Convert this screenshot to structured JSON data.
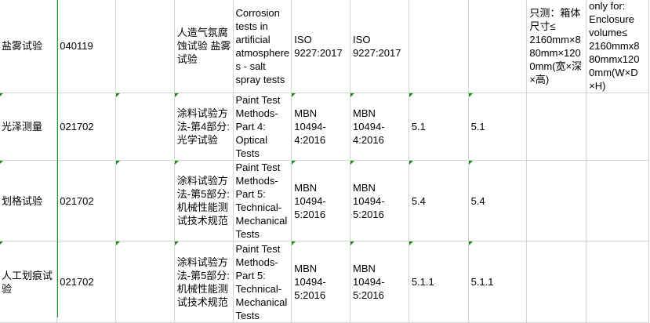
{
  "rows": [
    {
      "name": "row-salt-spray",
      "height": 112,
      "cells": [
        {
          "text": "盐雾试验",
          "mark": false
        },
        {
          "text": "040119",
          "mark": false
        },
        {
          "text": "",
          "mark": false
        },
        {
          "text": "人造气氛腐\n蚀试验 盐雾\n试验",
          "mark": false
        },
        {
          "text": "Corrosion\ntests in\nartificial\natmosphere\ns - salt\nspray tests",
          "mark": false
        },
        {
          "text": "ISO\n9227:2017",
          "mark": false
        },
        {
          "text": "ISO\n9227:2017",
          "mark": false
        },
        {
          "text": "",
          "mark": false
        },
        {
          "text": "",
          "mark": false
        },
        {
          "text": "只测：箱体\n尺寸≤\n2160mm×8\n80mm×120\n0mm(宽×深\n×高)",
          "mark": false
        },
        {
          "text": "only for:\nEnclosure\nvolume≤\n2160mmx8\n80mmx120\n0mm(W×D\n×H)",
          "mark": false
        }
      ]
    },
    {
      "name": "row-gloss",
      "height": 85,
      "cells": [
        {
          "text": "光泽测量",
          "mark": true
        },
        {
          "text": "021702",
          "mark": false
        },
        {
          "text": "",
          "mark": true
        },
        {
          "text": "涂料试验方\n法-第4部分:\n光学试验",
          "mark": true
        },
        {
          "text": "Paint Test\nMethods-\nPart 4:\nOptical\nTests",
          "mark": false
        },
        {
          "text": "MBN\n10494-\n4:2016",
          "mark": true
        },
        {
          "text": "MBN\n10494-\n4:2016",
          "mark": true
        },
        {
          "text": "5.1",
          "mark": true
        },
        {
          "text": "5.1",
          "mark": true
        },
        {
          "text": "",
          "mark": false
        },
        {
          "text": "",
          "mark": false
        }
      ]
    },
    {
      "name": "row-crosscut",
      "height": 102,
      "cells": [
        {
          "text": "划格试验",
          "mark": true
        },
        {
          "text": "021702",
          "mark": false
        },
        {
          "text": "",
          "mark": true
        },
        {
          "text": "涂料试验方\n法-第5部分:\n机械性能测\n试技术规范",
          "mark": true
        },
        {
          "text": "Paint Test\nMethods-\nPart 5:\nTechnical-\nMechanical\nTests",
          "mark": false
        },
        {
          "text": "MBN\n10494-\n5:2016",
          "mark": true
        },
        {
          "text": "MBN\n10494-\n5:2016",
          "mark": true
        },
        {
          "text": "5.4",
          "mark": true
        },
        {
          "text": "5.4",
          "mark": true
        },
        {
          "text": "",
          "mark": false
        },
        {
          "text": "",
          "mark": false
        }
      ]
    },
    {
      "name": "row-scratch",
      "height": 104,
      "cells": [
        {
          "text": "人工划痕试\n验",
          "mark": true
        },
        {
          "text": "021702",
          "mark": false
        },
        {
          "text": "",
          "mark": true
        },
        {
          "text": "涂料试验方\n法-第5部分:\n机械性能测\n试技术规范",
          "mark": true
        },
        {
          "text": "Paint Test\nMethods-\nPart 5:\nTechnical-\nMechanical\nTests",
          "mark": false
        },
        {
          "text": "MBN\n10494-\n5:2016",
          "mark": true
        },
        {
          "text": "MBN\n10494-\n5:2016",
          "mark": true
        },
        {
          "text": "5.1.1",
          "mark": true
        },
        {
          "text": "5.1.1",
          "mark": true
        },
        {
          "text": "",
          "mark": false
        },
        {
          "text": "",
          "mark": false
        }
      ]
    }
  ]
}
